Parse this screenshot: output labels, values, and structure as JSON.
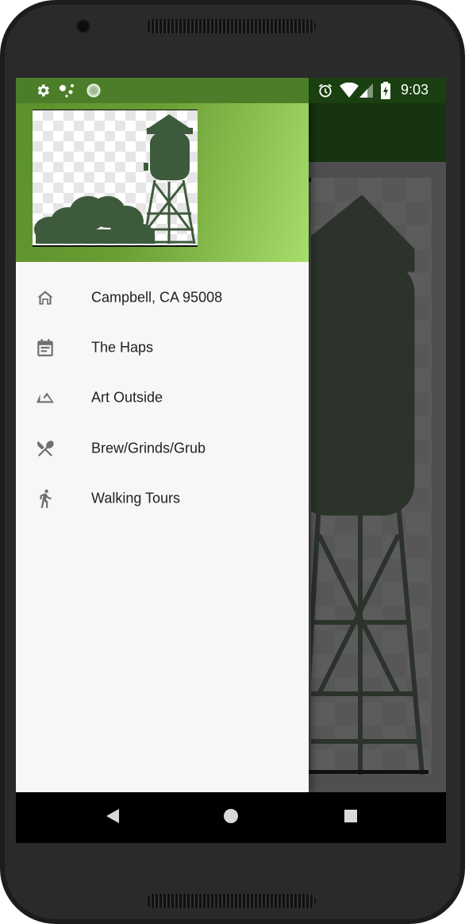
{
  "status_bar": {
    "time": "9:03",
    "left_icons": [
      "gear-icon",
      "assistant-dots-icon",
      "circle-icon"
    ],
    "right_icons": [
      "alarm-icon",
      "wifi-icon",
      "signal-icon",
      "battery-charging-icon"
    ]
  },
  "drawer": {
    "header_image": "water-tower-logo",
    "items": [
      {
        "label": "Campbell, CA 95008",
        "icon": "home-icon"
      },
      {
        "label": "The Haps",
        "icon": "event-note-icon"
      },
      {
        "label": "Art Outside",
        "icon": "landscape-icon"
      },
      {
        "label": "Brew/Grinds/Grub",
        "icon": "restaurant-icon"
      },
      {
        "label": "Walking Tours",
        "icon": "walk-icon"
      }
    ]
  },
  "nav_bar": {
    "buttons": [
      "back-icon",
      "home-circle-icon",
      "recents-square-icon"
    ]
  },
  "colors": {
    "drawer_header_start": "#5b8f2a",
    "drawer_header_end": "#a6dd6b",
    "toolbar": "#173310",
    "icon_gray": "#6f6f6f"
  }
}
